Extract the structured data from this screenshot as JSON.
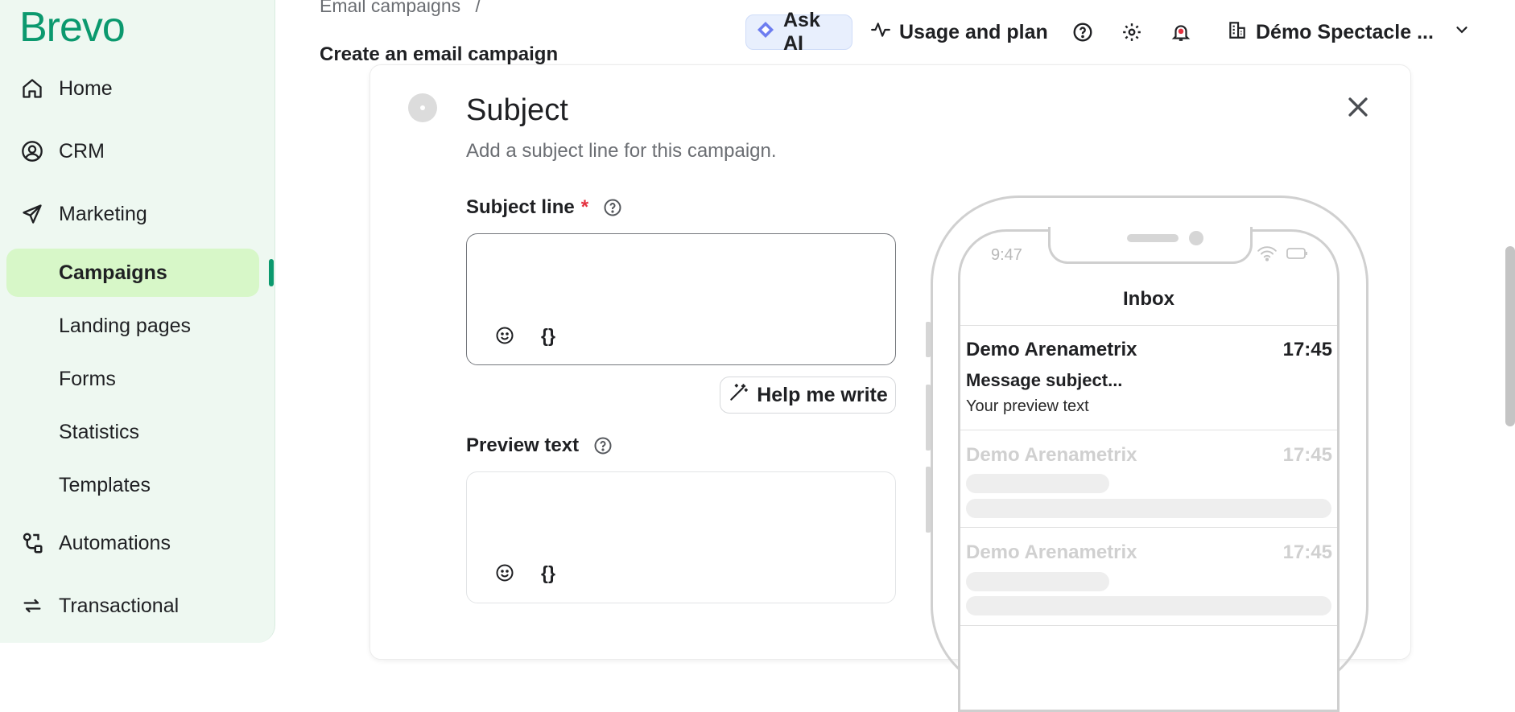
{
  "sidebar": {
    "logo": "Brevo",
    "nav": [
      {
        "label": "Home",
        "icon": "home-icon"
      },
      {
        "label": "CRM",
        "icon": "contact-icon"
      },
      {
        "label": "Marketing",
        "icon": "send-icon"
      }
    ],
    "marketing_sub": [
      {
        "label": "Campaigns",
        "active": true
      },
      {
        "label": "Landing pages"
      },
      {
        "label": "Forms"
      },
      {
        "label": "Statistics"
      },
      {
        "label": "Templates"
      }
    ],
    "bottom_nav": [
      {
        "label": "Automations",
        "icon": "automation-icon"
      },
      {
        "label": "Transactional",
        "icon": "transactional-icon"
      }
    ]
  },
  "header": {
    "breadcrumb": "Email campaigns",
    "breadcrumb_sep": "/",
    "page_title": "Create an email campaign",
    "ask_ai": "Ask AI",
    "usage": "Usage and plan",
    "account": "Démo Spectacle ..."
  },
  "subject_step": {
    "title": "Subject",
    "description": "Add a subject line for this campaign.",
    "subject_label": "Subject line",
    "required_mark": "*",
    "subject_value": "",
    "help_write": "Help me write",
    "preview_label": "Preview text",
    "preview_value": "",
    "var_token": "{}"
  },
  "phone": {
    "time": "9:47",
    "inbox": "Inbox",
    "mails": [
      {
        "from": "Demo Arenametrix",
        "time": "17:45",
        "subject": "Message subject...",
        "preview": "Your preview text"
      },
      {
        "from": "Demo Arenametrix",
        "time": "17:45"
      },
      {
        "from": "Demo Arenametrix",
        "time": "17:45"
      }
    ]
  },
  "colors": {
    "brand": "#0b996e",
    "sidebar_bg": "#eef8f1",
    "active_bg": "#d7f7c8",
    "required": "#e4313f",
    "ai_bg": "#e8effd"
  }
}
